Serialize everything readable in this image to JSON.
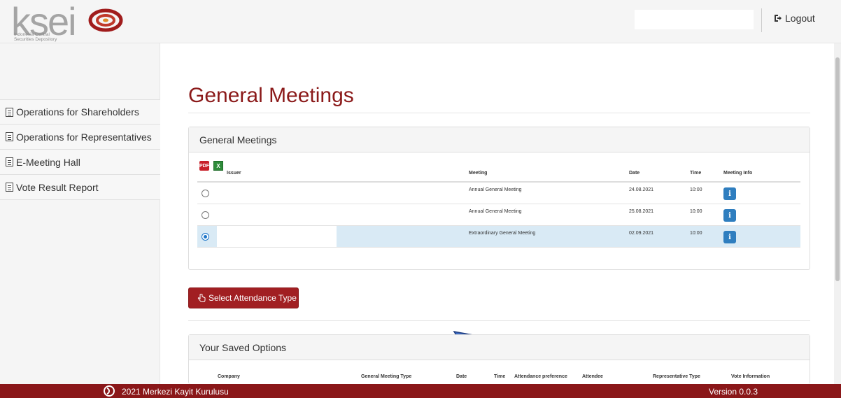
{
  "header": {
    "logo_text": "ksei",
    "logo_subtitle": "Indonesia Central Securities Depository",
    "logout_label": "Logout"
  },
  "sidebar": {
    "items": [
      {
        "label": "Operations for Shareholders"
      },
      {
        "label": "Operations for Representatives"
      },
      {
        "label": "E-Meeting Hall"
      },
      {
        "label": "Vote Result Report"
      }
    ]
  },
  "main": {
    "page_title": "General Meetings",
    "meetings_panel": {
      "title": "General Meetings",
      "columns": {
        "issuer": "Issuer",
        "meeting": "Meeting",
        "date": "Date",
        "time": "Time",
        "info": "Meeting Info"
      },
      "rows": [
        {
          "meeting": "Annual General Meeting",
          "date": "24.08.2021",
          "time": "10:00",
          "selected": false
        },
        {
          "meeting": "Annual General Meeting",
          "date": "25.08.2021",
          "time": "10:00",
          "selected": false
        },
        {
          "meeting": "Extraordinary General Meeting",
          "date": "02.09.2021",
          "time": "10:00",
          "selected": true
        }
      ],
      "info_glyph": "i"
    },
    "attendance_button_label": "Select Attendance Type",
    "saved_panel": {
      "title": "Your Saved Options",
      "columns": {
        "company": "Company",
        "meeting_type": "General Meeting Type",
        "date": "Date",
        "time": "Time",
        "preference": "Attendance preference",
        "attendee": "Attendee",
        "rep_type": "Representative Type",
        "vote_info": "Vote Information"
      }
    }
  },
  "footer": {
    "copyright": "2021 Merkezi Kayit Kurulusu",
    "version": "Version 0.0.3"
  },
  "colors": {
    "brand_red": "#8b1a1a",
    "button_red": "#a11f22",
    "info_blue": "#2f7ebf",
    "selected_row": "#d9eaf5"
  }
}
